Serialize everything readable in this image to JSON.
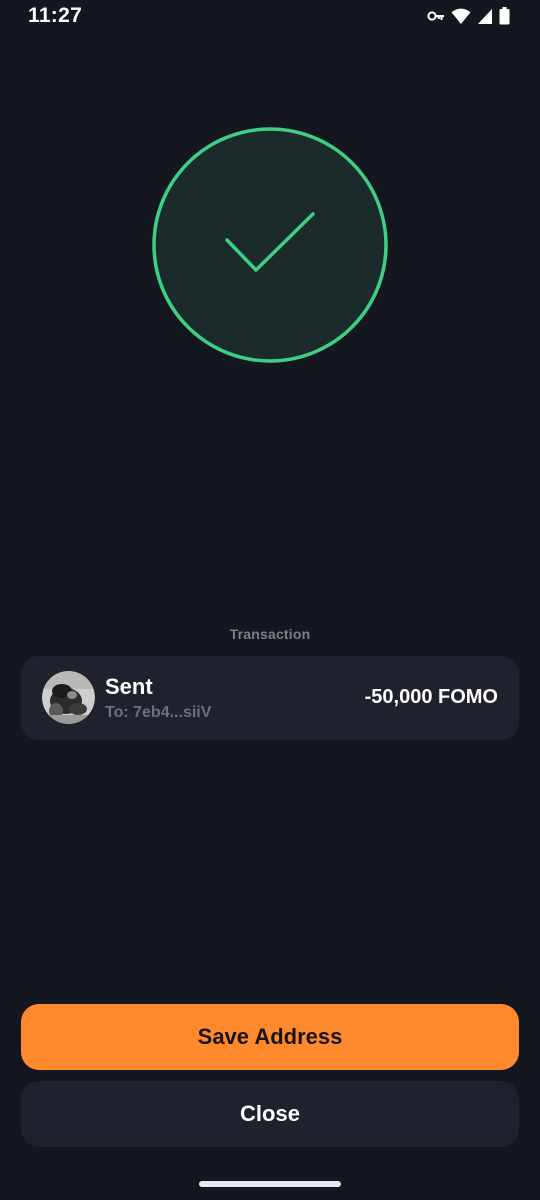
{
  "status_bar": {
    "time": "11:27",
    "icons": [
      "vpn-key-icon",
      "wifi-icon",
      "cellular-signal-icon",
      "battery-icon"
    ]
  },
  "success": {
    "icon": "checkmark-icon",
    "accent_color": "#3ecf85"
  },
  "transaction": {
    "section_label": "Transaction",
    "title": "Sent",
    "recipient": "To: 7eb4...siiV",
    "amount": "-50,000 FOMO",
    "avatar_icon": "token-avatar-icon"
  },
  "actions": {
    "save_address_label": "Save Address",
    "close_label": "Close",
    "primary_color": "#ff8a2d"
  }
}
